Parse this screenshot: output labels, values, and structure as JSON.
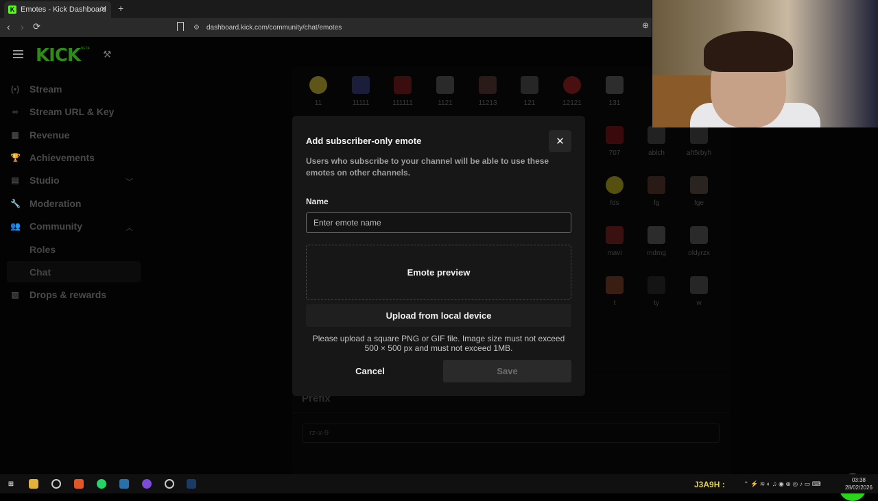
{
  "browser": {
    "tab_title": "Emotes - Kick Dashboard",
    "tab_favicon": "K",
    "tab_close": "✕",
    "new_tab": "+",
    "url": "dashboard.kick.com/community/chat/emotes"
  },
  "sidebar": {
    "logo": "KICK",
    "logo_badge": "BETA",
    "items": [
      {
        "label": "Stream",
        "icon": "(•)"
      },
      {
        "label": "Stream URL & Key",
        "icon": "∞"
      },
      {
        "label": "Revenue",
        "icon": "▦"
      },
      {
        "label": "Achievements",
        "icon": "🏆"
      },
      {
        "label": "Studio",
        "icon": "▤"
      },
      {
        "label": "Moderation",
        "icon": "🔧"
      },
      {
        "label": "Community",
        "icon": "👥"
      },
      {
        "label": "Drops & rewards",
        "icon": "▨"
      }
    ],
    "community_sub": [
      "Roles",
      "Chat"
    ]
  },
  "emotes": {
    "row1": [
      "11",
      "11111",
      "111111",
      "1121",
      "11213",
      "121",
      "12121",
      "131"
    ],
    "col_right": [
      [
        "707",
        "ablch",
        "aft5rbyh"
      ],
      [
        "fds",
        "fg",
        "fge"
      ],
      [
        "mavi",
        "mdmg",
        "oldyrzx"
      ],
      [
        "t",
        "ty",
        "w"
      ]
    ]
  },
  "prefix": {
    "title": "Prefix",
    "value": "rz-x-9"
  },
  "modal": {
    "title": "Add subscriber-only emote",
    "close": "✕",
    "description": "Users who subscribe to your channel will be able to use these emotes on other channels.",
    "name_label": "Name",
    "name_placeholder": "Enter emote name",
    "preview": "Emote preview",
    "upload": "Upload from local device",
    "help": "Please upload a square PNG or GIF file. Image size must not exceed 500 × 500 px and must not exceed 1MB.",
    "cancel": "Cancel",
    "save": "Save"
  },
  "taskbar": {
    "user_tag": "J3A9H :",
    "time": "03:38",
    "date": "28/02/2026"
  },
  "colors": {
    "brand": "#53fc18",
    "support": "#2bd41b"
  }
}
